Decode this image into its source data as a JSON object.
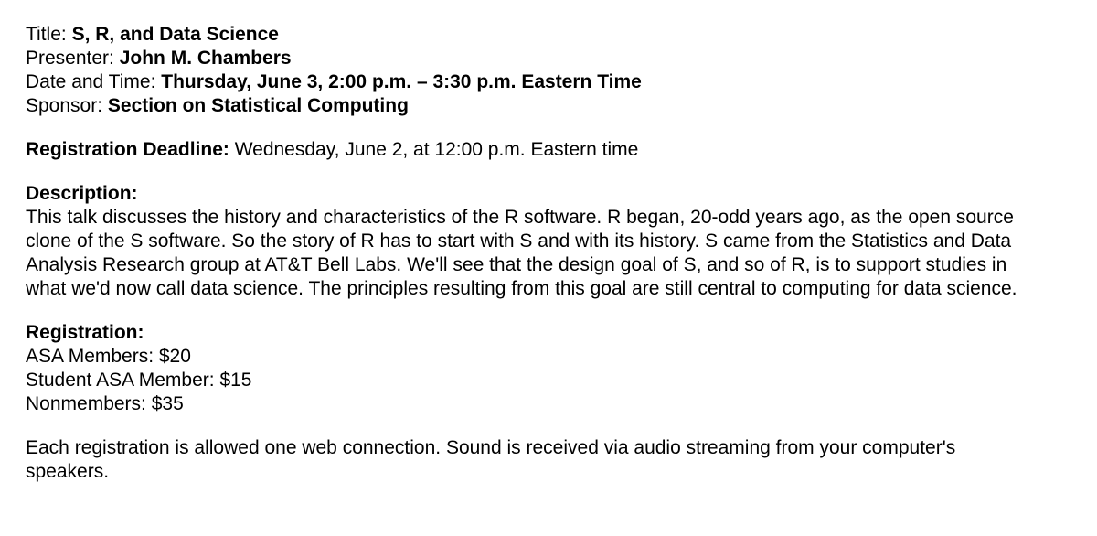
{
  "header": {
    "title_label": "Title:",
    "title_value": "S, R, and Data Science",
    "presenter_label": "Presenter:",
    "presenter_value": "John M. Chambers",
    "datetime_label": "Date and Time:",
    "datetime_value": "Thursday, June 3, 2:00 p.m. – 3:30 p.m. Eastern Time",
    "sponsor_label": "Sponsor:",
    "sponsor_value": "Section on Statistical Computing"
  },
  "deadline": {
    "label": "Registration Deadline:",
    "value": "Wednesday, June 2, at 12:00 p.m. Eastern time"
  },
  "description": {
    "heading": "Description:",
    "lines": [
      "This talk discusses the history and characteristics of the R software. R began, 20-odd years ago, as the open source",
      "clone of the S software. So the story of R has to start with S and with its history. S came from the Statistics and Data",
      "Analysis Research group at AT&T Bell Labs. We'll see that the design goal of S, and so of R, is to support studies in",
      "what we'd now call data science. The principles resulting from this goal are still central to computing for data science."
    ]
  },
  "registration": {
    "heading": "Registration:",
    "items": [
      "ASA Members: $20",
      "Student ASA Member: $15",
      "Nonmembers: $35"
    ]
  },
  "closing": {
    "lines": [
      "Each registration is allowed one web connection. Sound is received via audio streaming from your computer's",
      "speakers."
    ]
  }
}
